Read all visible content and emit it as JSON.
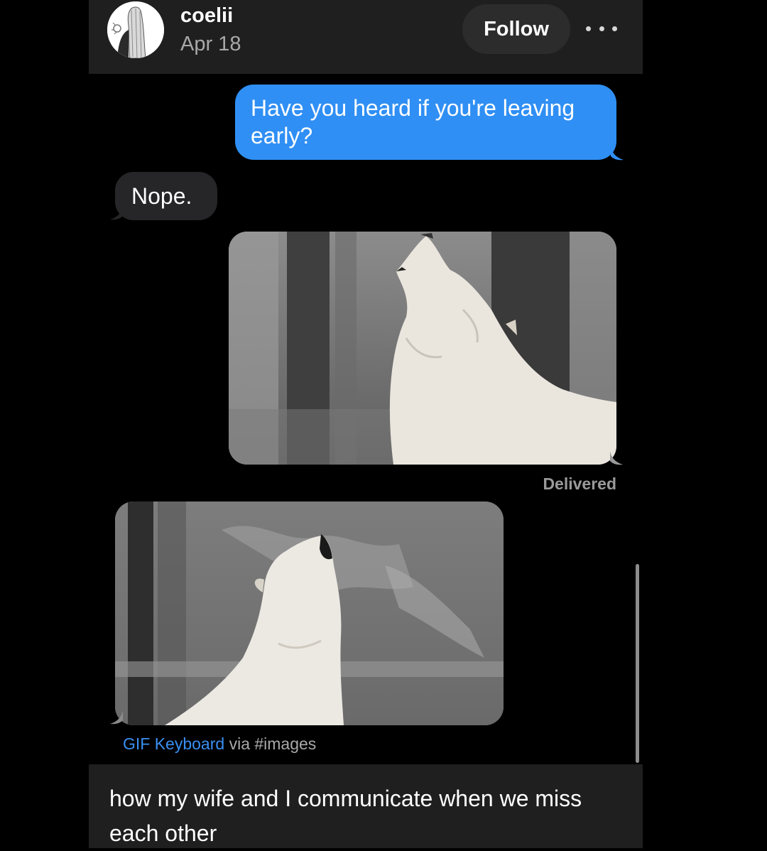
{
  "header": {
    "username": "coelii",
    "date": "Apr 18",
    "follow_label": "Follow",
    "more_icon": "more-horizontal-icon"
  },
  "messages": [
    {
      "type": "text",
      "direction": "sent",
      "text": "Have you heard if you're leaving early?"
    },
    {
      "type": "text",
      "direction": "received",
      "text": "Nope."
    },
    {
      "type": "gif",
      "direction": "sent",
      "subject": "howling-wolf-gif"
    },
    {
      "type": "gif",
      "direction": "received",
      "subject": "howling-wolf-gif"
    }
  ],
  "status": {
    "delivered": "Delivered"
  },
  "gif_credit": {
    "link": "GIF Keyboard",
    "suffix": " via #images"
  },
  "caption": "how my wife and I communicate when we miss each other",
  "colors": {
    "sent_bubble": "#2f8ff4",
    "received_bubble": "#262628",
    "header_bg": "#1f1f1f",
    "link": "#3a8ff2"
  }
}
